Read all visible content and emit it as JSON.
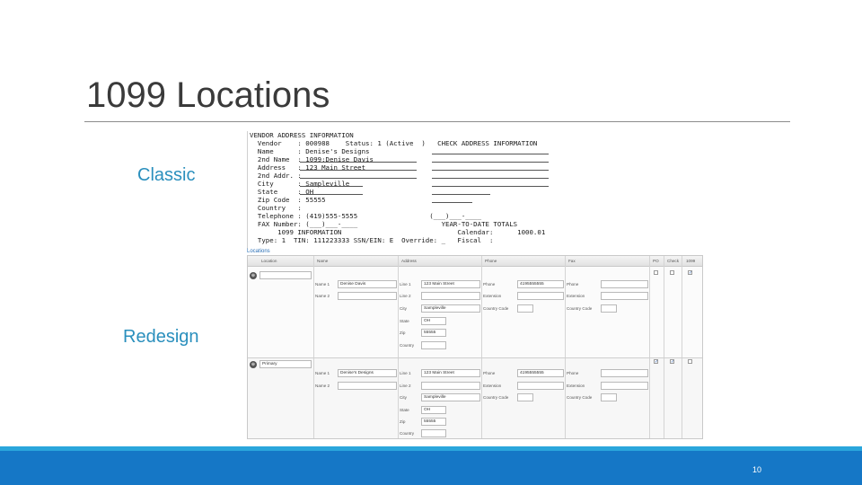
{
  "slide": {
    "title": "1099 Locations",
    "page_number": "10"
  },
  "labels": {
    "classic": "Classic",
    "redesign": "Redesign"
  },
  "classic": {
    "lines": [
      "VENDOR ADDRESS INFORMATION",
      "  Vendor    : 000988    Status: 1 (Active  )   CHECK ADDRESS INFORMATION",
      "  Name      : Denise's Designs",
      "  2nd Name  : 1099:Denise Davis",
      "  Address   : 123 Main Street",
      "  2nd Addr. :",
      "  City      : Sampleville",
      "  State     : OH",
      "  Zip Code  : 55555",
      "  Country   :",
      "  Telephone : (419)555-5555                  (___)___-____",
      "  FAX Number: (___)___-____                     YEAR-TO-DATE TOTALS",
      "       1099 INFORMATION                             Calendar:      1000.01",
      "  Type: 1  TIN: 111223333 SSN/EIN: E  Override: _   Fiscal  :"
    ]
  },
  "redesign": {
    "tab_label": "Locations",
    "headers": [
      "Location",
      "Name",
      "Address",
      "Phone",
      "Fax",
      "PO",
      "Check",
      "1099"
    ],
    "field_labels": {
      "name1": "Name 1",
      "name2": "Name 2",
      "line1": "Line 1",
      "line2": "Line 2",
      "city": "City",
      "state": "State",
      "zip": "Zip",
      "country": "Country",
      "phone": "Phone",
      "extension": "Extension",
      "country_code": "Country Code"
    },
    "rows": [
      {
        "location": "",
        "name1": "Denise Davis",
        "name2": "",
        "line1": "123 Main Street",
        "line2": "",
        "city": "Sampleville",
        "state": "OH",
        "zip": "55555",
        "country": "",
        "phone": "4195555555",
        "extension": "",
        "country_code": "",
        "fax_phone": "",
        "fax_extension": "",
        "fax_country_code": "",
        "po": "",
        "check": "",
        "n1099": "✓"
      },
      {
        "location": "Primary",
        "name1": "Denise's Designs",
        "name2": "",
        "line1": "123 Main Street",
        "line2": "",
        "city": "Sampleville",
        "state": "OH",
        "zip": "55555",
        "country": "",
        "phone": "4195555555",
        "extension": "",
        "country_code": "",
        "fax_phone": "",
        "fax_extension": "",
        "fax_country_code": "",
        "po": "✓",
        "check": "✓",
        "n1099": ""
      }
    ]
  },
  "colors": {
    "accent": "#2a8fbd",
    "footer": "#1577c6",
    "footer_top": "#2aa6dc"
  }
}
